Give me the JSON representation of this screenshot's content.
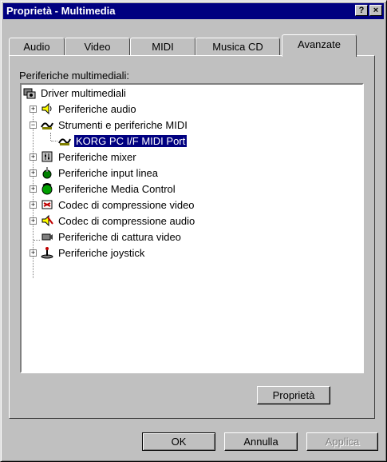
{
  "window": {
    "title": "Proprietà - Multimedia",
    "help_btn": "?",
    "close_btn": "×"
  },
  "tabs": [
    "Audio",
    "Video",
    "MIDI",
    "Musica CD",
    "Avanzate"
  ],
  "active_tab": "Avanzate",
  "panel": {
    "label": "Periferiche multimediali:"
  },
  "tree": {
    "root": "Driver multimediali",
    "items": [
      "Periferiche audio",
      "Strumenti e periferiche MIDI",
      "KORG PC I/F MIDI Port",
      "Periferiche mixer",
      "Periferiche input linea",
      "Periferiche Media Control",
      "Codec di compressione video",
      "Codec di compressione audio",
      "Periferiche di cattura video",
      "Periferiche joystick"
    ],
    "selected": "KORG PC I/F MIDI Port",
    "expanded": "Strumenti e periferiche MIDI"
  },
  "buttons": {
    "properties": "Proprietà",
    "ok": "OK",
    "cancel": "Annulla",
    "apply": "Applica"
  },
  "colors": {
    "face": "#c0c0c0",
    "titlebar": "#000080",
    "selection": "#000080"
  }
}
